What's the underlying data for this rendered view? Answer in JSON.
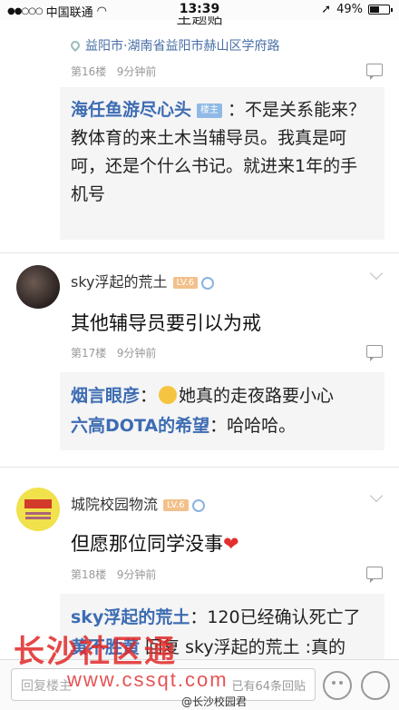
{
  "status": {
    "carrier": "中国联通",
    "time": "13:39",
    "battery": "49%",
    "battery_level": 0.49
  },
  "nav": {
    "title": "主题贴"
  },
  "top_post": {
    "location": "益阳市·湖南省益阳市赫山区学府路",
    "floor": "第16楼",
    "time": "9分钟前"
  },
  "sub1": {
    "user": "海任鱼游尽心头",
    "tag": "楼主",
    "text": "：不是关系能来？教体育的来土木当辅导员。我真是呵呵，还是个什么书记。就进来1年的手机号"
  },
  "floor17": {
    "user": "sky浮起的荒土",
    "level": "LV.6",
    "content": "其他辅导员要引以为戒",
    "floor": "第17楼",
    "time": "9分钟前",
    "replies": [
      {
        "user": "烟言眼彦",
        "text": "她真的走夜路要小心"
      },
      {
        "user": "六高DOTA的希望",
        "text": "：哈哈哈。"
      }
    ]
  },
  "floor18": {
    "user": "城院校园物流",
    "level": "LV.6",
    "content": "但愿那位同学没事",
    "heart": "❤",
    "floor": "第18楼",
    "time": "9分钟前",
    "replies": [
      {
        "user": "sky浮起的荒土",
        "text": "：120已经确认死亡了"
      },
      {
        "user": "黄不胜黄",
        "text": "回复 sky浮起的荒土 :真的"
      }
    ]
  },
  "bottom": {
    "placeholder": "回复楼主",
    "count": "已有64条回贴"
  },
  "watermark": {
    "cn": "长沙社区通",
    "url": "www.cssqt.com",
    "weibo": "@长沙校园君"
  }
}
